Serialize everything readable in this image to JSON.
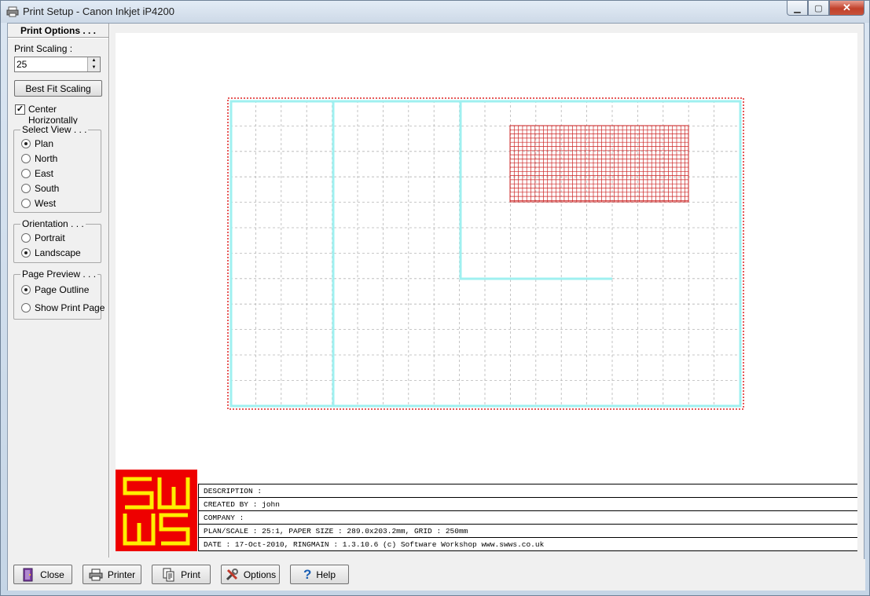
{
  "window": {
    "title": "Print Setup - Canon Inkjet iP4200"
  },
  "print_options": {
    "heading": "Print Options . . .",
    "scaling_label": "Print Scaling :",
    "scaling_value": "25",
    "best_fit_label": "Best Fit Scaling",
    "center_horizontally_label": "Center Horizontally",
    "center_horizontally_checked": true
  },
  "select_view": {
    "title": "Select View . . .",
    "options": [
      "Plan",
      "North",
      "East",
      "South",
      "West"
    ],
    "selected": "Plan"
  },
  "orientation": {
    "title": "Orientation . . .",
    "options": [
      "Portrait",
      "Landscape"
    ],
    "selected": "Landscape"
  },
  "page_preview": {
    "title": "Page Preview . . .",
    "options": [
      "Page Outline",
      "Show Print Page"
    ],
    "selected": "Page Outline"
  },
  "title_block": {
    "logo_text": "SWWS",
    "rows": [
      "DESCRIPTION :",
      "CREATED BY : john",
      "COMPANY :",
      "PLAN/SCALE : 25:1, PAPER SIZE : 289.0x203.2mm, GRID : 250mm",
      "DATE : 17-Oct-2010, RINGMAIN : 1.3.10.6 (c) Software Workshop www.swws.co.uk"
    ]
  },
  "buttons": {
    "close": "Close",
    "printer": "Printer",
    "print": "Print",
    "options": "Options",
    "help": "Help"
  },
  "colors": {
    "grid": "#b5b5b5",
    "wall": "#9ff0f0",
    "hatch": "#cc2222",
    "outline": "#dd2222",
    "logo_bg": "#ee0000",
    "logo_fg": "#ffee00"
  }
}
